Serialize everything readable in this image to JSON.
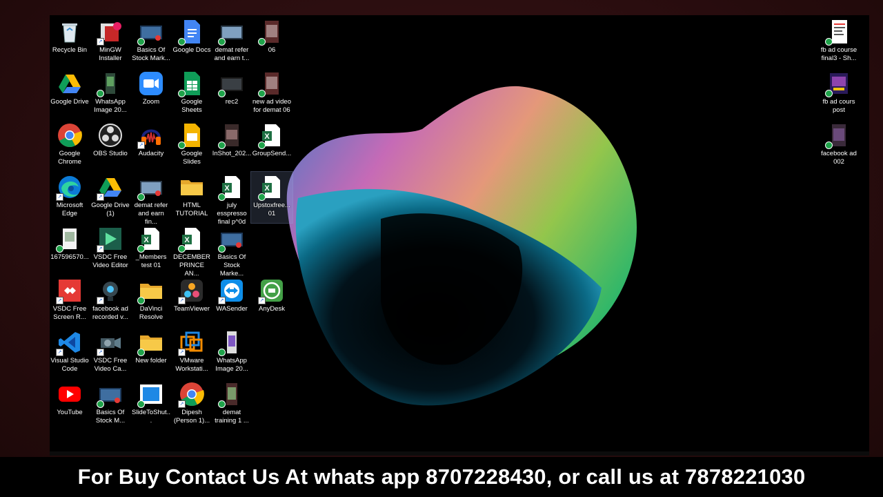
{
  "desktop": {
    "icons": [
      {
        "label": "Recycle Bin",
        "icon": "recycle-bin-icon"
      },
      {
        "label": "MinGW Installer",
        "icon": "mingw-icon"
      },
      {
        "label": "Basics Of Stock Mark...",
        "icon": "video-file-icon"
      },
      {
        "label": "Google Docs",
        "icon": "google-docs-icon"
      },
      {
        "label": "demat refer and earn t...",
        "icon": "video-file-icon"
      },
      {
        "label": "06",
        "icon": "image-file-icon"
      },
      {
        "label": "Google Drive",
        "icon": "google-drive-icon"
      },
      {
        "label": "WhatsApp Image 20...",
        "icon": "image-file-icon"
      },
      {
        "label": "Zoom",
        "icon": "zoom-icon"
      },
      {
        "label": "Google Sheets",
        "icon": "google-sheets-icon"
      },
      {
        "label": "rec2",
        "icon": "video-file-icon"
      },
      {
        "label": "new ad video for demat 06",
        "icon": "image-file-icon"
      },
      {
        "label": "Google Chrome",
        "icon": "chrome-icon"
      },
      {
        "label": "OBS Studio",
        "icon": "obs-icon"
      },
      {
        "label": "Audacity",
        "icon": "audacity-icon"
      },
      {
        "label": "Google Slides",
        "icon": "google-slides-icon"
      },
      {
        "label": "InShot_202...",
        "icon": "image-file-icon"
      },
      {
        "label": "GroupSend...",
        "icon": "excel-file-icon"
      },
      {
        "label": "Microsoft Edge",
        "icon": "edge-icon"
      },
      {
        "label": "Google Drive (1)",
        "icon": "google-drive-icon"
      },
      {
        "label": "demat refer and earn fin...",
        "icon": "video-file-icon"
      },
      {
        "label": "HTML TUTORIAL",
        "icon": "folder-icon"
      },
      {
        "label": "july esspresso final p^0d",
        "icon": "excel-file-icon"
      },
      {
        "label": "Upstoxfree... 01",
        "icon": "excel-file-icon"
      },
      {
        "label": "167596570...",
        "icon": "image-file-icon"
      },
      {
        "label": "VSDC Free Video Editor",
        "icon": "vsdc-editor-icon"
      },
      {
        "label": "_Members test 01",
        "icon": "excel-file-icon"
      },
      {
        "label": "DECEMBER PRINCE AN...",
        "icon": "excel-file-icon"
      },
      {
        "label": "Basics Of Stock Marke...",
        "icon": "video-file-icon"
      },
      {
        "label": "AnyDesk",
        "icon": "anydesk-icon"
      },
      {
        "label": "VSDC Free Screen R...",
        "icon": "vsdc-recorder-icon"
      },
      {
        "label": "facebook ad recorded v...",
        "icon": "folder-icon"
      },
      {
        "label": "DaVinci Resolve",
        "icon": "davinci-icon"
      },
      {
        "label": "TeamViewer",
        "icon": "teamviewer-icon"
      },
      {
        "label": "WASender",
        "icon": "wasender-icon"
      },
      {
        "label": "Visual Studio Code",
        "icon": "vscode-icon"
      },
      {
        "label": "VSDC Free Video Ca...",
        "icon": "vsdc-capture-icon"
      },
      {
        "label": "New folder",
        "icon": "folder-icon"
      },
      {
        "label": "VMware Workstati...",
        "icon": "vmware-icon"
      },
      {
        "label": "WhatsApp Image 20...",
        "icon": "image-file-icon"
      },
      {
        "label": "YouTube",
        "icon": "youtube-icon"
      },
      {
        "label": "Basics Of Stock M...",
        "icon": "video-file-icon"
      },
      {
        "label": "SlideToShut...",
        "icon": "slidetoshut-icon"
      },
      {
        "label": "Dipesh (Person 1)...",
        "icon": "chrome-icon"
      },
      {
        "label": "demat training 1 ...",
        "icon": "image-file-icon"
      },
      {
        "label": "fb ad course final3 - Sh...",
        "icon": "document-image-icon"
      },
      {
        "label": "fb ad cours post",
        "icon": "image-file-icon"
      },
      {
        "label": "facebook ad 002",
        "icon": "image-file-icon"
      }
    ]
  },
  "banner": {
    "text": "For Buy Contact Us At whats app 8707228430, or call us at 7878221030"
  }
}
